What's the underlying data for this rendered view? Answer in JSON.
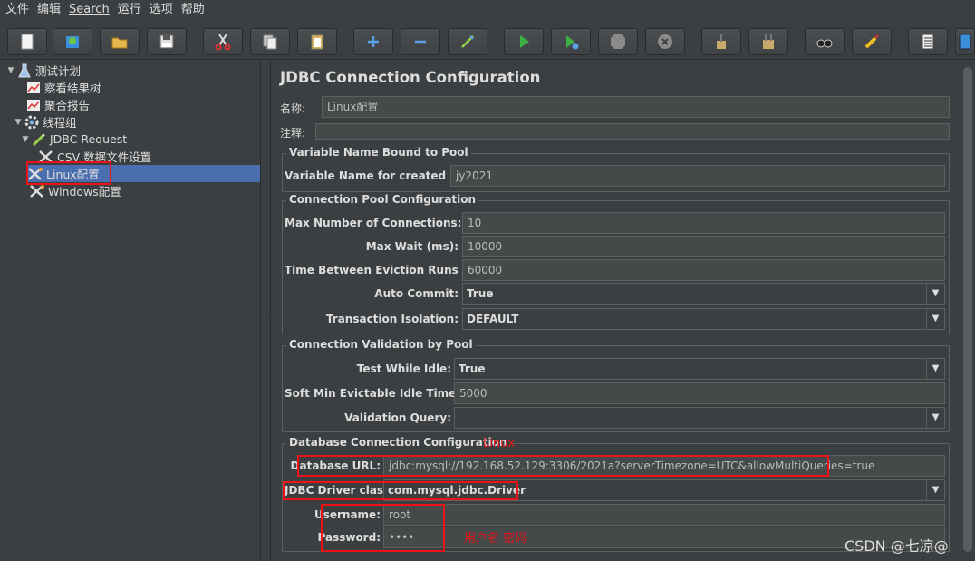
{
  "menu": {
    "items": [
      "文件",
      "编辑",
      "Search",
      "运行",
      "选项",
      "帮助"
    ]
  },
  "toolbar": {
    "buttons": [
      "new-icon",
      "templates-icon",
      "open-icon",
      "save-icon",
      "cut-icon",
      "copy-icon",
      "paste-icon",
      "expand-icon",
      "collapse-icon",
      "toggle-icon",
      "start-icon",
      "start-no-pause-icon",
      "stop-icon",
      "shutdown-icon",
      "clear-icon",
      "clear-all-icon",
      "search-icon",
      "reset-search-icon",
      "function-helper-icon",
      "help-icon"
    ]
  },
  "tree": {
    "items": [
      {
        "label": "测试计划",
        "icon": "test-plan-icon"
      },
      {
        "label": "察看结果树",
        "icon": "listener-icon"
      },
      {
        "label": "聚合报告",
        "icon": "listener-icon"
      },
      {
        "label": "线程组",
        "icon": "gear-icon"
      },
      {
        "label": "JDBC Request",
        "icon": "sampler-icon"
      },
      {
        "label": "CSV 数据文件设置",
        "icon": "config-icon"
      },
      {
        "label": "Linux配置",
        "icon": "config-icon"
      },
      {
        "label": "Windows配置",
        "icon": "config-icon"
      }
    ]
  },
  "panel": {
    "title": "JDBC Connection Configuration",
    "name_label": "名称:",
    "name_value": "Linux配置",
    "comment_label": "注释:",
    "comment_value": "",
    "groups": {
      "bound": "Variable Name Bound to Pool",
      "pool": "Connection Pool Configuration",
      "validation": "Connection Validation by Pool",
      "db": "Database Connection Configuration"
    },
    "var_name_label": "Variable Name for created pool:",
    "var_name_value": "jy2021",
    "max_conn_label": "Max Number of Connections:",
    "max_conn_value": "10",
    "max_wait_label": "Max Wait (ms):",
    "max_wait_value": "10000",
    "eviction_label": "Time Between Eviction Runs (ms):",
    "eviction_value": "60000",
    "auto_commit_label": "Auto Commit:",
    "auto_commit_value": "True",
    "isolation_label": "Transaction Isolation:",
    "isolation_value": "DEFAULT",
    "test_idle_label": "Test While Idle:",
    "test_idle_value": "True",
    "soft_min_label": "Soft Min Evictable Idle Time(ms):",
    "soft_min_value": "5000",
    "validation_query_label": "Validation Query:",
    "validation_query_value": "",
    "db_url_label": "Database URL:",
    "db_url_value": "jdbc:mysql://192.168.52.129:3306/2021a?serverTimezone=UTC&allowMultiQueries=true",
    "driver_label": "JDBC Driver class:",
    "driver_value": "com.mysql.jdbc.Driver",
    "username_label": "Username:",
    "username_value": "root",
    "password_label": "Password:",
    "password_value": "••••"
  },
  "annotations": {
    "linux": "Linux",
    "userpass": "用户名  密码"
  },
  "watermark": "CSDN @七凉@",
  "colors": {
    "background": "#3c3f41",
    "selection": "#4b6eaf",
    "annotation_red": "#e8141a"
  }
}
